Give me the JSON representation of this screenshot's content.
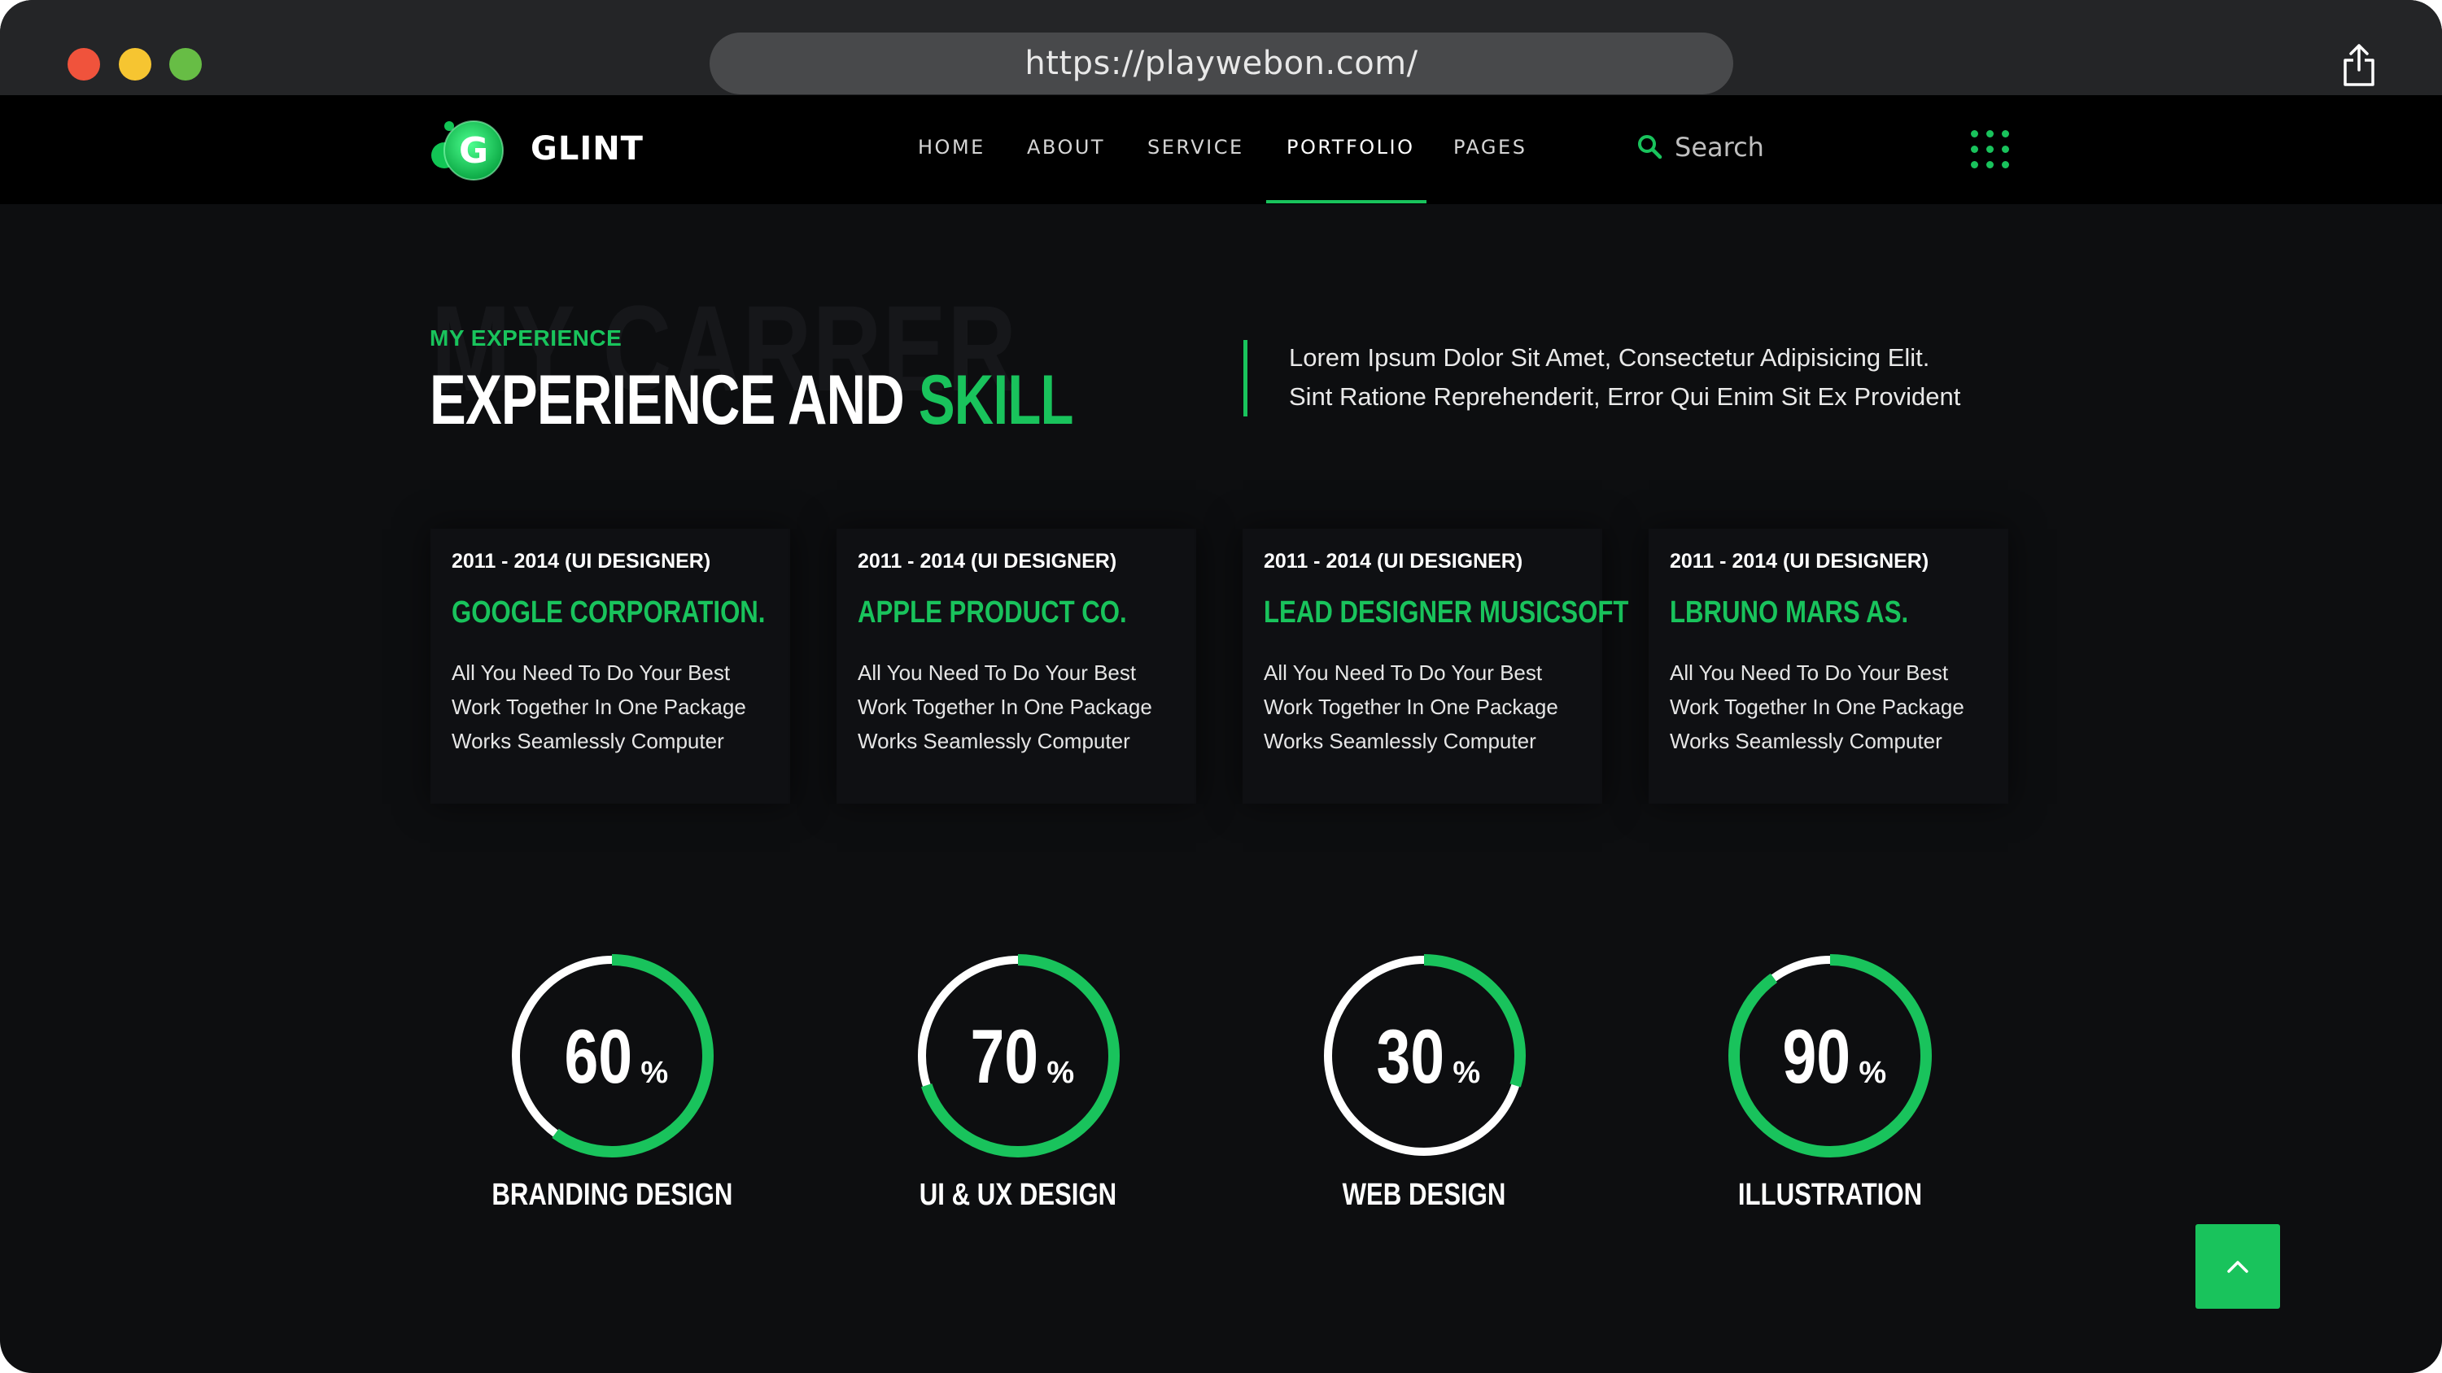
{
  "browser": {
    "url": "https://playwebon.com/"
  },
  "nav": {
    "brand": "GLINT",
    "brand_letter": "G",
    "items": [
      "HOME",
      "ABOUT",
      "SERVICE",
      "PORTFOLIO",
      "PAGES"
    ],
    "active": "PORTFOLIO",
    "search_placeholder": "Search"
  },
  "section": {
    "background_word": "MY CARRER",
    "subtitle": "MY EXPERIENCE",
    "title_main": "EXPERIENCE AND ",
    "title_accent": "SKILL",
    "description_line1": "Lorem Ipsum Dolor Sit Amet, Consectetur Adipisicing Elit.",
    "description_line2": "Sint Ratione Reprehenderit, Error Qui Enim Sit Ex Provident"
  },
  "experience": [
    {
      "period": "2011 - 2014 (UI DESIGNER)",
      "company": "GOOGLE CORPORATION.",
      "line1": "All You Need To Do Your Best",
      "line2": "Work Together In One Package",
      "line3": "Works Seamlessly Computer"
    },
    {
      "period": "2011 - 2014 (UI DESIGNER)",
      "company": "APPLE PRODUCT CO.",
      "line1": "All You Need To Do Your Best",
      "line2": "Work Together In One Package",
      "line3": "Works Seamlessly Computer"
    },
    {
      "period": "2011 - 2014 (UI DESIGNER)",
      "company": "LEAD DESIGNER MUSICSOFT",
      "line1": "All You Need To Do Your Best",
      "line2": "Work Together In One Package",
      "line3": "Works Seamlessly Computer"
    },
    {
      "period": "2011 - 2014 (UI DESIGNER)",
      "company": "LBRUNO MARS AS.",
      "line1": "All You Need To Do Your Best",
      "line2": "Work Together In One Package",
      "line3": "Works Seamlessly Computer"
    }
  ],
  "skills": [
    {
      "label": "BRANDING DESIGN",
      "value": "60",
      "percent": 60
    },
    {
      "label": "UI & UX DESIGN",
      "value": "70",
      "percent": 70
    },
    {
      "label": "WEB DESIGN",
      "value": "30",
      "percent": 30
    },
    {
      "label": "ILLUSTRATION",
      "value": "90",
      "percent": 90
    }
  ],
  "percent_sign": "%",
  "colors": {
    "accent": "#19c35c",
    "background": "#0d0e10",
    "nav_background": "#000000",
    "ring_track": "#ffffff"
  },
  "icons": {
    "share": "share-icon",
    "search": "search-icon",
    "menu": "grid-menu-icon",
    "scroll_top": "chevron-up-icon"
  }
}
